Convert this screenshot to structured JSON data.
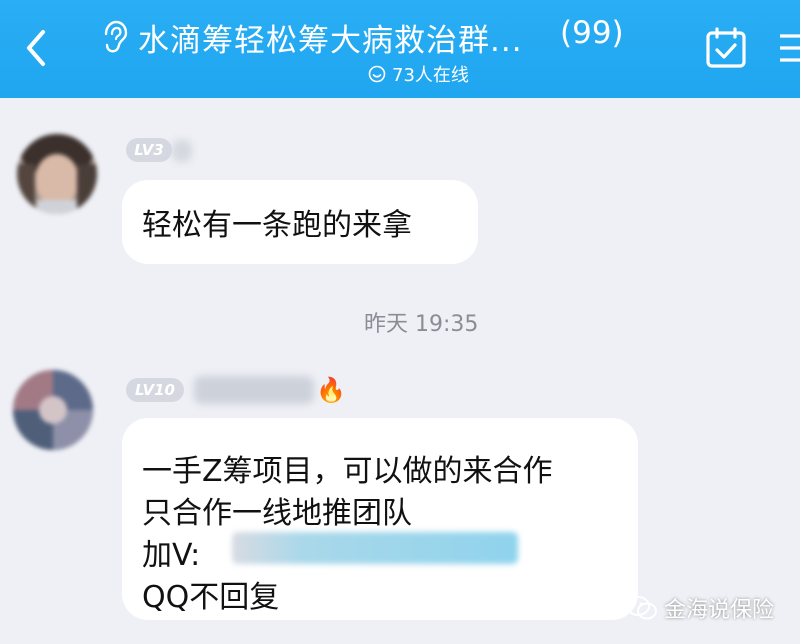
{
  "header": {
    "title": "水滴筹轻松筹大病救治群...",
    "member_count": "(99)",
    "online_text": "73人在线"
  },
  "messages": [
    {
      "level": "LV3",
      "text": "轻松有一条跑的来拿"
    },
    {
      "level": "LV10",
      "lines": [
        "一手Z筹项目，可以做的来合作",
        "只合作一线地推团队",
        "加V:",
        "QQ不回复"
      ]
    }
  ],
  "timestamp": "昨天 19:35",
  "watermark": "金海说保险",
  "colors": {
    "header": "#22aaf2",
    "background": "#eef0f5",
    "bubble": "#ffffff"
  }
}
